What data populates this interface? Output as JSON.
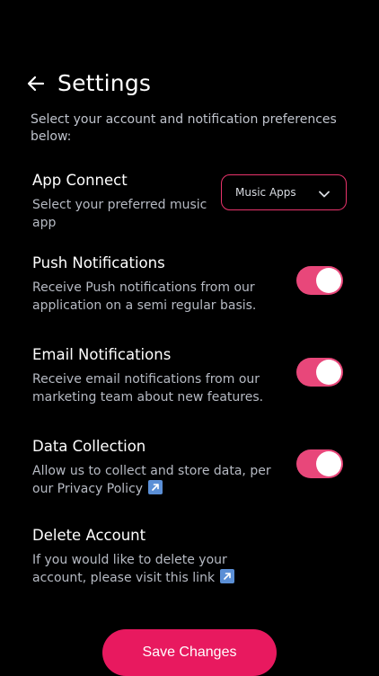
{
  "header": {
    "title": "Settings"
  },
  "intro": "Select your account and notification preferences below:",
  "app_connect": {
    "title": "App Connect",
    "description": "Select your preferred music app",
    "dropdown_value": "Music Apps"
  },
  "push_notifications": {
    "title": "Push Notifications",
    "description": "Receive Push notifications from our application on a semi regular basis.",
    "enabled": true
  },
  "email_notifications": {
    "title": "Email Notifications",
    "description": "Receive email notifications from our marketing team about new features.",
    "enabled": true
  },
  "data_collection": {
    "title": "Data Collection",
    "description": "Allow us to collect and store data, per our Privacy Policy",
    "enabled": true
  },
  "delete_account": {
    "title": "Delete Account",
    "description": "If you would like to delete your account, please visit this link"
  },
  "save_button_label": "Save Changes",
  "colors": {
    "background": "#000000",
    "accent": "#e8195f",
    "toggle_on": "#e8477a",
    "link_icon": "#5b8fd6"
  }
}
